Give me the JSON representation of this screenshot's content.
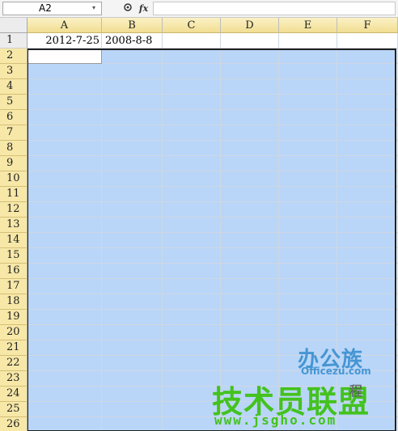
{
  "formula_bar": {
    "name_box": "A2",
    "name_box_arrow": "▾",
    "zoom_icon": "🔍",
    "fx_label": "fx",
    "formula": ""
  },
  "columns": [
    "A",
    "B",
    "C",
    "D",
    "E",
    "F"
  ],
  "rows": [
    "1",
    "2",
    "3",
    "4",
    "5",
    "6",
    "7",
    "8",
    "9",
    "10",
    "11",
    "12",
    "13",
    "14",
    "15",
    "16",
    "17",
    "18",
    "19",
    "20",
    "21",
    "22",
    "23",
    "24",
    "25",
    "26"
  ],
  "cells": {
    "A1": "2012-7-25",
    "B1": "2008-8-8"
  },
  "selection": {
    "range_start": "A2",
    "color": "#b9d6f8"
  },
  "watermark": {
    "line1": "办公族",
    "line2": "Officezu.com",
    "line3": "技术员联盟",
    "line4": "www.jsgho.com",
    "line5": "程"
  }
}
